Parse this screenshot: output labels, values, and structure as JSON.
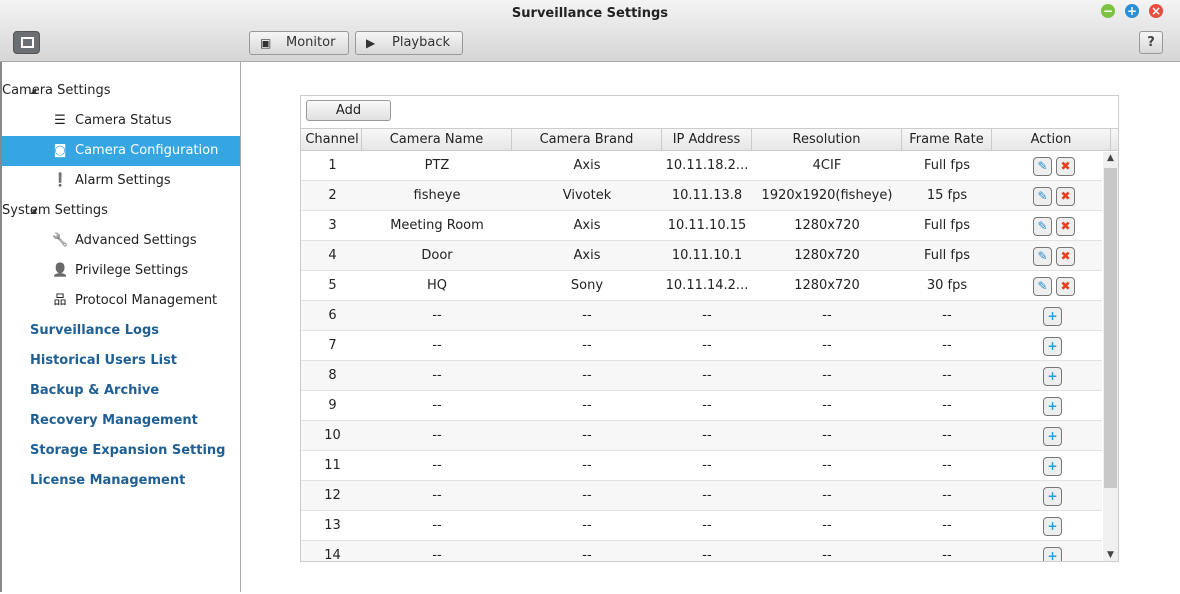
{
  "window": {
    "title": "Surveillance Settings"
  },
  "toolbar": {
    "monitor": "Monitor",
    "playback": "Playback",
    "help": "?"
  },
  "sidebar": [
    {
      "label": "Camera Settings",
      "type": "group",
      "icon": "triangle-icon"
    },
    {
      "label": "Camera Status",
      "type": "sub",
      "icon": "list-icon"
    },
    {
      "label": "Camera Configuration",
      "type": "sub",
      "icon": "camera-icon",
      "selected": true
    },
    {
      "label": "Alarm Settings",
      "type": "sub",
      "icon": "alarm-icon"
    },
    {
      "label": "System Settings",
      "type": "group",
      "icon": "triangle-icon"
    },
    {
      "label": "Advanced Settings",
      "type": "sub",
      "icon": "wrench-icon"
    },
    {
      "label": "Privilege Settings",
      "type": "sub",
      "icon": "user-icon"
    },
    {
      "label": "Protocol Management",
      "type": "sub",
      "icon": "network-icon"
    },
    {
      "label": "Surveillance Logs",
      "type": "top"
    },
    {
      "label": "Historical Users List",
      "type": "top"
    },
    {
      "label": "Backup & Archive",
      "type": "top"
    },
    {
      "label": "Recovery Management",
      "type": "top"
    },
    {
      "label": "Storage Expansion Setting",
      "type": "top"
    },
    {
      "label": "License Management",
      "type": "top"
    }
  ],
  "table": {
    "add": "Add",
    "columns": [
      "Channel",
      "Camera Name",
      "Camera Brand",
      "IP Address",
      "Resolution",
      "Frame Rate",
      "Action"
    ],
    "rows": [
      [
        "1",
        "PTZ",
        "Axis",
        "10.11.18.2...",
        "4CIF",
        "Full fps"
      ],
      [
        "2",
        "fisheye",
        "Vivotek",
        "10.11.13.8",
        "1920x1920(fisheye)",
        "15 fps"
      ],
      [
        "3",
        "Meeting Room",
        "Axis",
        "10.11.10.15",
        "1280x720",
        "Full fps"
      ],
      [
        "4",
        "Door",
        "Axis",
        "10.11.10.1",
        "1280x720",
        "Full fps"
      ],
      [
        "5",
        "HQ",
        "Sony",
        "10.11.14.2...",
        "1280x720",
        "30 fps"
      ],
      [
        "6",
        "--",
        "--",
        "--",
        "--",
        "--"
      ],
      [
        "7",
        "--",
        "--",
        "--",
        "--",
        "--"
      ],
      [
        "8",
        "--",
        "--",
        "--",
        "--",
        "--"
      ],
      [
        "9",
        "--",
        "--",
        "--",
        "--",
        "--"
      ],
      [
        "10",
        "--",
        "--",
        "--",
        "--",
        "--"
      ],
      [
        "11",
        "--",
        "--",
        "--",
        "--",
        "--"
      ],
      [
        "12",
        "--",
        "--",
        "--",
        "--",
        "--"
      ],
      [
        "13",
        "--",
        "--",
        "--",
        "--",
        "--"
      ],
      [
        "14",
        "--",
        "--",
        "--",
        "--",
        "--"
      ]
    ]
  },
  "colors": {
    "accent": "#35a6e2",
    "link": "#1f5f94",
    "close": "#e84c3d",
    "min": "#7dc242",
    "max": "#2a8fd6"
  }
}
